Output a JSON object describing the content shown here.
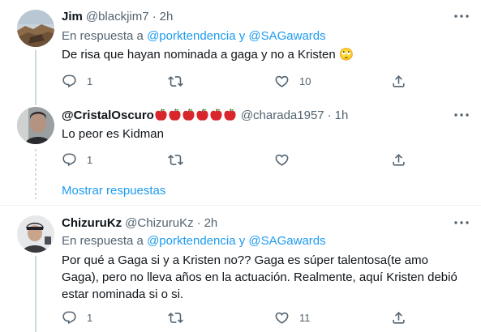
{
  "tweets": [
    {
      "name": "Jim",
      "handle": "@blackjim7",
      "time": "2h",
      "reply_prefix": "En respuesta a",
      "reply_user1": "@porktendencia",
      "reply_conj": "y",
      "reply_user2": "@SAGawards",
      "text": "De risa que hayan nominada a gaga y no a Kristen 🙄",
      "replies": "1",
      "retweets": "",
      "likes": "10"
    },
    {
      "name": "@CristalOscuro",
      "handle": "@charada1957",
      "time": "1h",
      "text": "Lo peor es Kidman",
      "replies": "1",
      "retweets": "",
      "likes": ""
    },
    {
      "name": "ChizuruKz",
      "handle": "@ChizuruKz",
      "time": "2h",
      "reply_prefix": "En respuesta a",
      "reply_user1": "@porktendencia",
      "reply_conj": "y",
      "reply_user2": "@SAGawards",
      "text": "Por qué a Gaga si y a Kristen no?? Gaga es súper talentosa(te amo Gaga), pero no lleva años en la actuación. Realmente, aquí Kristen debió estar nominada si o si.",
      "replies": "1",
      "retweets": "",
      "likes": "11"
    }
  ],
  "show_replies": "Mostrar respuestas",
  "separator": "·",
  "icons": {
    "reply": "reply-icon",
    "retweet": "retweet-icon",
    "like": "heart-icon",
    "share": "share-icon",
    "more": "more-icon",
    "apple": "red-apple-emoji"
  },
  "colors": {
    "link": "#1d9bf0",
    "secondary": "#536471",
    "text": "#0f1419",
    "apple": "#d8262c"
  }
}
